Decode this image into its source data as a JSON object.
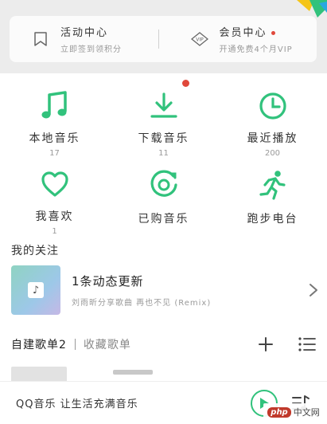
{
  "promo": {
    "left": {
      "title": "活动中心",
      "subtitle": "立即签到领积分",
      "icon": "bookmark-icon"
    },
    "right": {
      "title": "会员中心",
      "subtitle": "开通免费4个月VIP",
      "icon": "vip-icon",
      "has_dot": true
    }
  },
  "accent_color": "#31c27c",
  "grid": [
    {
      "label": "本地音乐",
      "count": "17",
      "icon": "music-note-icon"
    },
    {
      "label": "下载音乐",
      "count": "11",
      "icon": "download-icon",
      "has_dot": true
    },
    {
      "label": "最近播放",
      "count": "200",
      "icon": "clock-icon"
    },
    {
      "label": "我喜欢",
      "count": "1",
      "icon": "heart-icon"
    },
    {
      "label": "已购音乐",
      "count": "",
      "icon": "purchased-disc-icon"
    },
    {
      "label": "跑步电台",
      "count": "",
      "icon": "running-icon"
    }
  ],
  "follow": {
    "section_title": "我的关注",
    "title": "1条动态更新",
    "subtitle": "刘雨昕分享歌曲 再也不见 (Remix)"
  },
  "tabs": {
    "active": "自建歌单2",
    "inactive": "收藏歌单"
  },
  "player": {
    "text": "QQ音乐 让生活充满音乐"
  },
  "watermark": {
    "brand": "php",
    "site": "中文网"
  }
}
